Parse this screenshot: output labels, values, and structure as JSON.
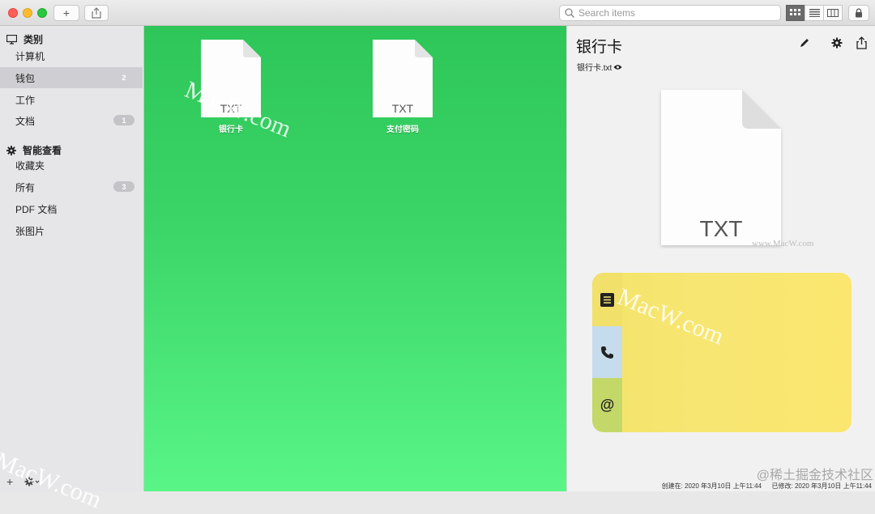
{
  "toolbar": {
    "add_label": "+",
    "search_placeholder": "Search items"
  },
  "sidebar": {
    "sections": [
      {
        "title": "类别",
        "icon": "monitor-icon",
        "items": [
          {
            "label": "计算机",
            "badge": ""
          },
          {
            "label": "钱包",
            "badge": "2",
            "selected": true
          },
          {
            "label": "工作",
            "badge": ""
          },
          {
            "label": "文档",
            "badge": "1"
          }
        ]
      },
      {
        "title": "智能查看",
        "icon": "gear-icon",
        "items": [
          {
            "label": "收藏夹",
            "badge": ""
          },
          {
            "label": "所有",
            "badge": "3"
          },
          {
            "label": "PDF 文档",
            "badge": ""
          },
          {
            "label": "张图片",
            "badge": ""
          }
        ]
      }
    ],
    "bottom_add": "+"
  },
  "files": [
    {
      "name": "银行卡",
      "type": "TXT"
    },
    {
      "name": "支付密码",
      "type": "TXT"
    }
  ],
  "detail": {
    "title": "银行卡",
    "filename": "银行卡.txt",
    "preview_type": "TXT",
    "card_tabs": [
      "notes-icon",
      "phone-icon",
      "at-sign-icon"
    ],
    "at_label": "@",
    "created": "创建在: 2020 年3月10日 上午11:44",
    "modified": "已修改: 2020 年3月10日 上午11:44"
  },
  "watermarks": {
    "macw": "MacW.com",
    "macw_url": "www.MacW.com",
    "juejin": "@稀土掘金技术社区"
  },
  "colors": {
    "content_green": "#3ad466",
    "card_yellow": "#f7e672",
    "card_phone_tab": "#c6dcec",
    "card_at_tab": "#c4d86a"
  }
}
